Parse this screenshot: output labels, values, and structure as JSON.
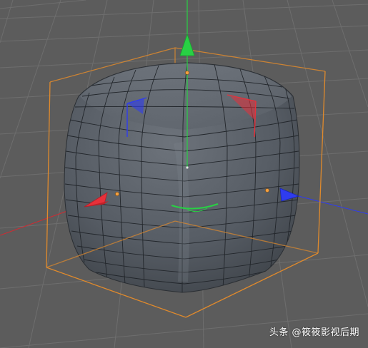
{
  "viewport": {
    "object_type": "rounded cube (subdivided mesh)",
    "background_color": "#5c5c5c",
    "grid_line_color": "#6e6e6e",
    "mesh_color": "#5a6068",
    "wire_color": "#22262b",
    "bounding_box_color": "#e08a2c",
    "axis_colors": {
      "x": "#e8303a",
      "y": "#28d044",
      "z": "#2f3cf0"
    },
    "icons": [
      "y-axis-arrow-icon",
      "x-axis-arrow-icon",
      "z-axis-arrow-icon",
      "rotation-handle-icon"
    ]
  },
  "watermark": {
    "text": "头条 @筱筱影视后期"
  }
}
